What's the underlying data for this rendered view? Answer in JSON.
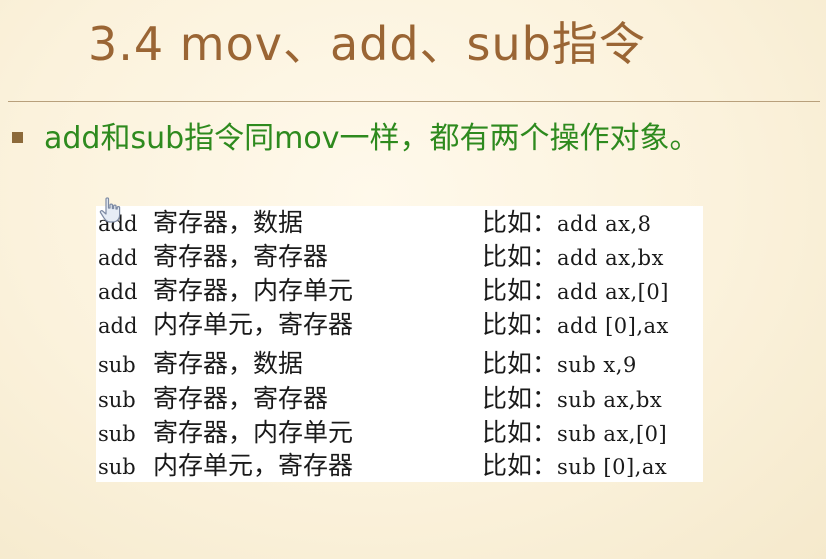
{
  "slide": {
    "title": "3.4 mov、add、sub指令",
    "bullet": "add和sub指令同mov一样，都有两个操作对象。"
  },
  "table": {
    "rows": [
      {
        "op": "add",
        "desc": "寄存器，数据",
        "example_label": "比如：",
        "example_code": "add ax,8"
      },
      {
        "op": "add",
        "desc": "寄存器，寄存器",
        "example_label": "比如：",
        "example_code": "add ax,bx"
      },
      {
        "op": "add",
        "desc": "寄存器，内存单元",
        "example_label": "比如：",
        "example_code": "add ax,[0]"
      },
      {
        "op": "add",
        "desc": "内存单元，寄存器",
        "example_label": "比如：",
        "example_code": "add [0],ax"
      },
      {
        "op": "sub",
        "desc": "寄存器，数据",
        "example_label": "比如：",
        "example_code": "sub x,9"
      },
      {
        "op": "sub",
        "desc": "寄存器，寄存器",
        "example_label": "比如：",
        "example_code": "sub ax,bx"
      },
      {
        "op": "sub",
        "desc": "寄存器，内存单元",
        "example_label": "比如：",
        "example_code": "sub ax,[0]"
      },
      {
        "op": "sub",
        "desc": "内存单元，寄存器",
        "example_label": "比如：",
        "example_code": "sub [0],ax"
      }
    ]
  },
  "colors": {
    "title": "#9a6534",
    "bullet_text": "#2e8a1e",
    "bullet_square": "#8c6a3a",
    "background": "#fbf3df"
  },
  "icons": {
    "cursor": "hand-pointer-icon"
  }
}
